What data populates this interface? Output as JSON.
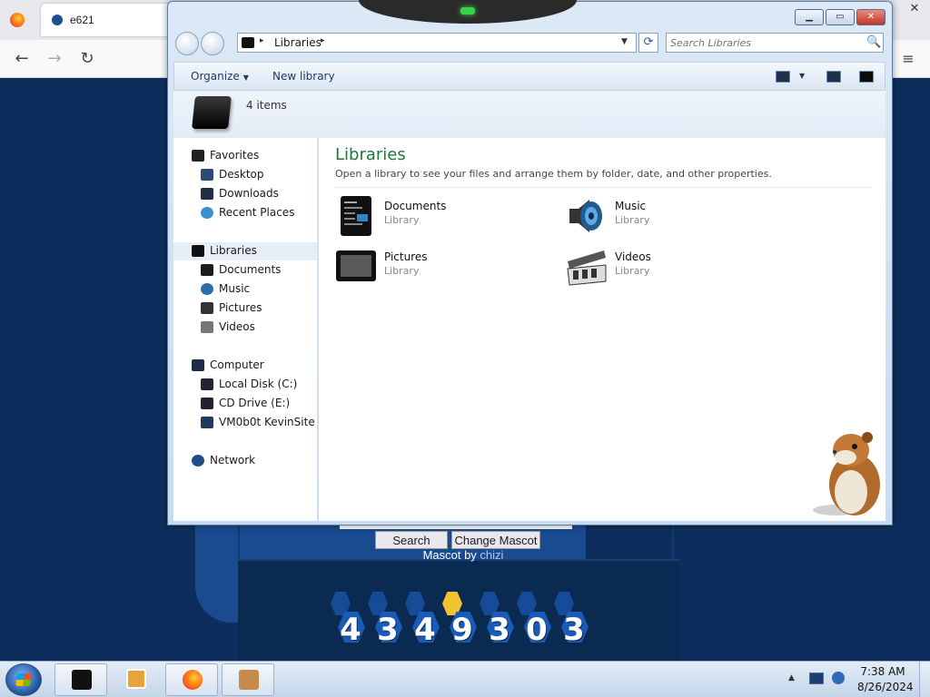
{
  "browser": {
    "tab_title": "e621",
    "close_label": "✕",
    "menu_label": "≡",
    "back_label": "←",
    "forward_label": "→",
    "reload_label": "↻"
  },
  "site": {
    "search_label": "Search",
    "change_mascot_label": "Change Mascot",
    "mascot_prefix": "Mascot by ",
    "mascot_author": "chizi",
    "counter_digits": [
      "4",
      "3",
      "4",
      "9",
      "3",
      "0",
      "3"
    ]
  },
  "window": {
    "min_label": "▁",
    "max_label": "▭",
    "close_label": "✕",
    "address": {
      "crumb": "Libraries",
      "sep": "▸",
      "drop": "▼"
    },
    "refresh_label": "⟳",
    "search": {
      "placeholder": "Search Libraries",
      "icon": "🔍"
    },
    "toolbar": {
      "organize": "Organize",
      "organize_arrow": "▼",
      "new_library": "New library",
      "view_arrow": "▼"
    },
    "details": {
      "count": "4 items"
    },
    "nav": {
      "favorites": "Favorites",
      "desktop": "Desktop",
      "downloads": "Downloads",
      "recent": "Recent Places",
      "libraries": "Libraries",
      "documents": "Documents",
      "music": "Music",
      "pictures": "Pictures",
      "videos": "Videos",
      "computer": "Computer",
      "local_disk": "Local Disk (C:)",
      "cd_drive": "CD Drive (E:)",
      "vm_share": "VM0b0t KevinSite",
      "network": "Network"
    },
    "content": {
      "header": "Libraries",
      "subtitle": "Open a library to see your files and arrange them by folder, date, and other properties.",
      "items": [
        {
          "name": "Documents",
          "type": "Library"
        },
        {
          "name": "Music",
          "type": "Library"
        },
        {
          "name": "Pictures",
          "type": "Library"
        },
        {
          "name": "Videos",
          "type": "Library"
        }
      ]
    }
  },
  "taskbar": {
    "tray_arrow": "▲",
    "time": "7:38 AM",
    "date": "8/26/2024"
  },
  "colors": {
    "library_header": "#1a7a3a",
    "site_background": "#0d2e5c"
  }
}
